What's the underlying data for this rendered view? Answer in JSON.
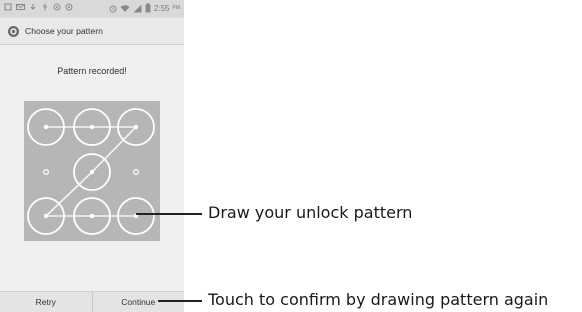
{
  "status_bar": {
    "time": "2:55",
    "time_suffix": "PM",
    "left_icons": [
      "notification-icon",
      "mail-icon",
      "download-icon",
      "usb-icon",
      "sync-icon",
      "sync-icon"
    ],
    "right_icons": [
      "alarm-icon",
      "wifi-icon",
      "signal-icon",
      "battery-icon"
    ]
  },
  "app_bar": {
    "icon": "settings-icon",
    "title": "Choose your pattern"
  },
  "header_message": "Pattern recorded!",
  "pattern": {
    "grid": "3x3",
    "sequence": [
      3,
      1,
      2,
      3,
      5,
      7
    ],
    "dots_selected": [
      1,
      2,
      3,
      5,
      7,
      8,
      9
    ],
    "pad_color": "#b6b6b6",
    "ring_color": "#ffffff"
  },
  "buttons": {
    "retry_label": "Retry",
    "continue_label": "Continue"
  },
  "callouts": {
    "draw_pattern": "Draw your unlock pattern",
    "confirm": "Touch to confirm by drawing pattern again"
  }
}
